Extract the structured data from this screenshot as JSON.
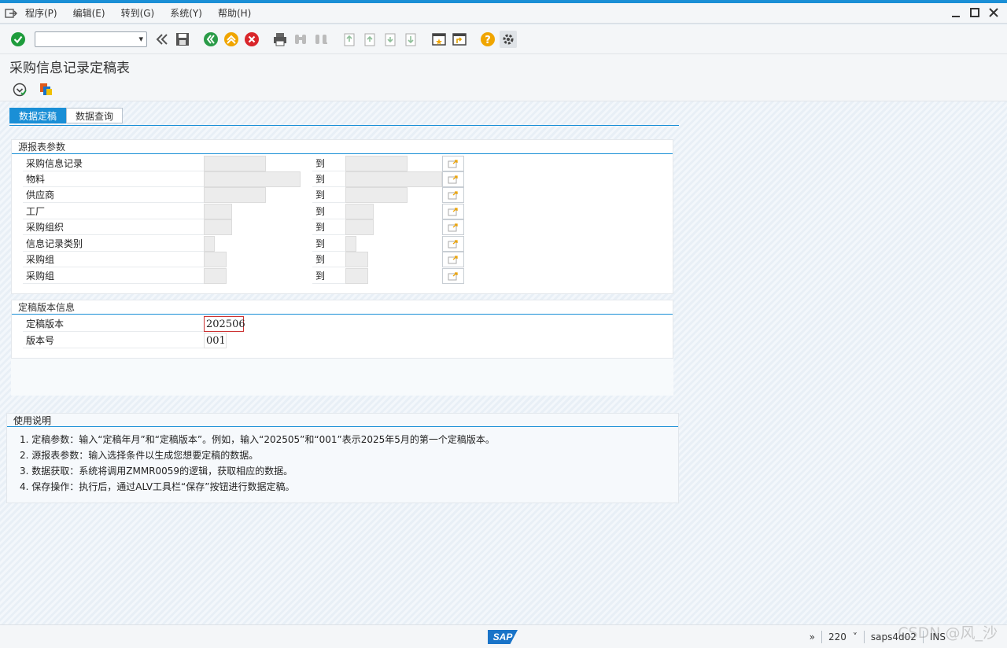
{
  "menubar": {
    "items": [
      "程序(P)",
      "编辑(E)",
      "转到(G)",
      "系统(Y)",
      "帮助(H)"
    ]
  },
  "toolbar": {
    "command_field_value": ""
  },
  "page": {
    "title": "采购信息记录定稿表"
  },
  "tabs": [
    "数据定稿",
    "数据查询"
  ],
  "source_params": {
    "title": "源报表参数",
    "to_label": "到",
    "rows": [
      {
        "label": "采购信息记录"
      },
      {
        "label": "物料"
      },
      {
        "label": "供应商"
      },
      {
        "label": "工厂"
      },
      {
        "label": "采购组织"
      },
      {
        "label": "信息记录类别"
      },
      {
        "label": "采购组"
      },
      {
        "label": "采购组"
      }
    ]
  },
  "version_info": {
    "title": "定稿版本信息",
    "version_label": "定稿版本",
    "version_value": "202506",
    "number_label": "版本号",
    "number_value": "001"
  },
  "help": {
    "title": "使用说明",
    "items": [
      "1. 定稿参数：输入“定稿年月”和“定稿版本”。例如，输入“202505”和“001”表示2025年5月的第一个定稿版本。",
      "2. 源报表参数：输入选择条件以生成您想要定稿的数据。",
      "3. 数据获取：系统将调用ZMMR0059的逻辑，获取相应的数据。",
      "4. 保存操作：执行后，通过ALV工具栏“保存”按钮进行数据定稿。"
    ]
  },
  "statusbar": {
    "logo": "SAP",
    "arrows": "»",
    "client": "220",
    "client_dd": "˅",
    "server": "saps4d02",
    "mode": "INS"
  },
  "watermark": "CSDN @风_沙",
  "colors": {
    "accent": "#1a8fd6",
    "ok_green": "#1e9c3c",
    "cancel_red": "#d9262b",
    "back_green": "#2a9b48",
    "exit_orange": "#f0a500"
  }
}
